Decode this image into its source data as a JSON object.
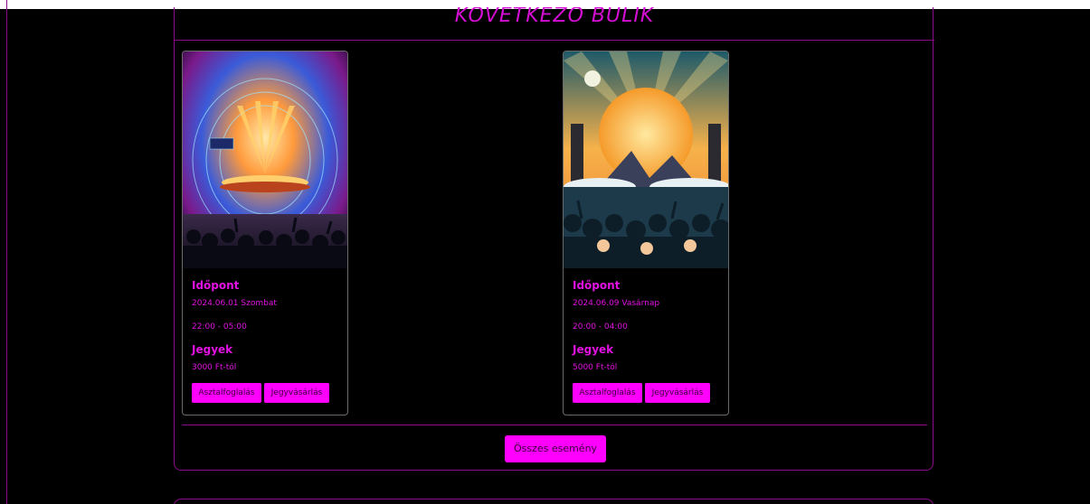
{
  "section": {
    "title": "KÖVETKEZŐ BULIK",
    "all_events_label": "Összes esemény"
  },
  "events": [
    {
      "poster_icon": "rock-concert-poster",
      "time_label": "Időpont",
      "date": "2024.06.01 Szombat",
      "hours": "22:00 - 05:00",
      "tickets_label": "Jegyek",
      "price": "3000 Ft-tól",
      "table_button": "Asztalfoglalás",
      "ticket_button": "Jegyvásárlás"
    },
    {
      "poster_icon": "sunset-festival-poster",
      "time_label": "Időpont",
      "date": "2024.06.09 Vasárnap",
      "hours": "20:00 - 04:00",
      "tickets_label": "Jegyek",
      "price": "5000 Ft-tól",
      "table_button": "Asztalfoglalás",
      "ticket_button": "Jegyvásárlás"
    }
  ],
  "colors": {
    "accent": "#ff00ff",
    "text": "#e212e2",
    "border": "#8c0b8c",
    "background": "#000000"
  }
}
